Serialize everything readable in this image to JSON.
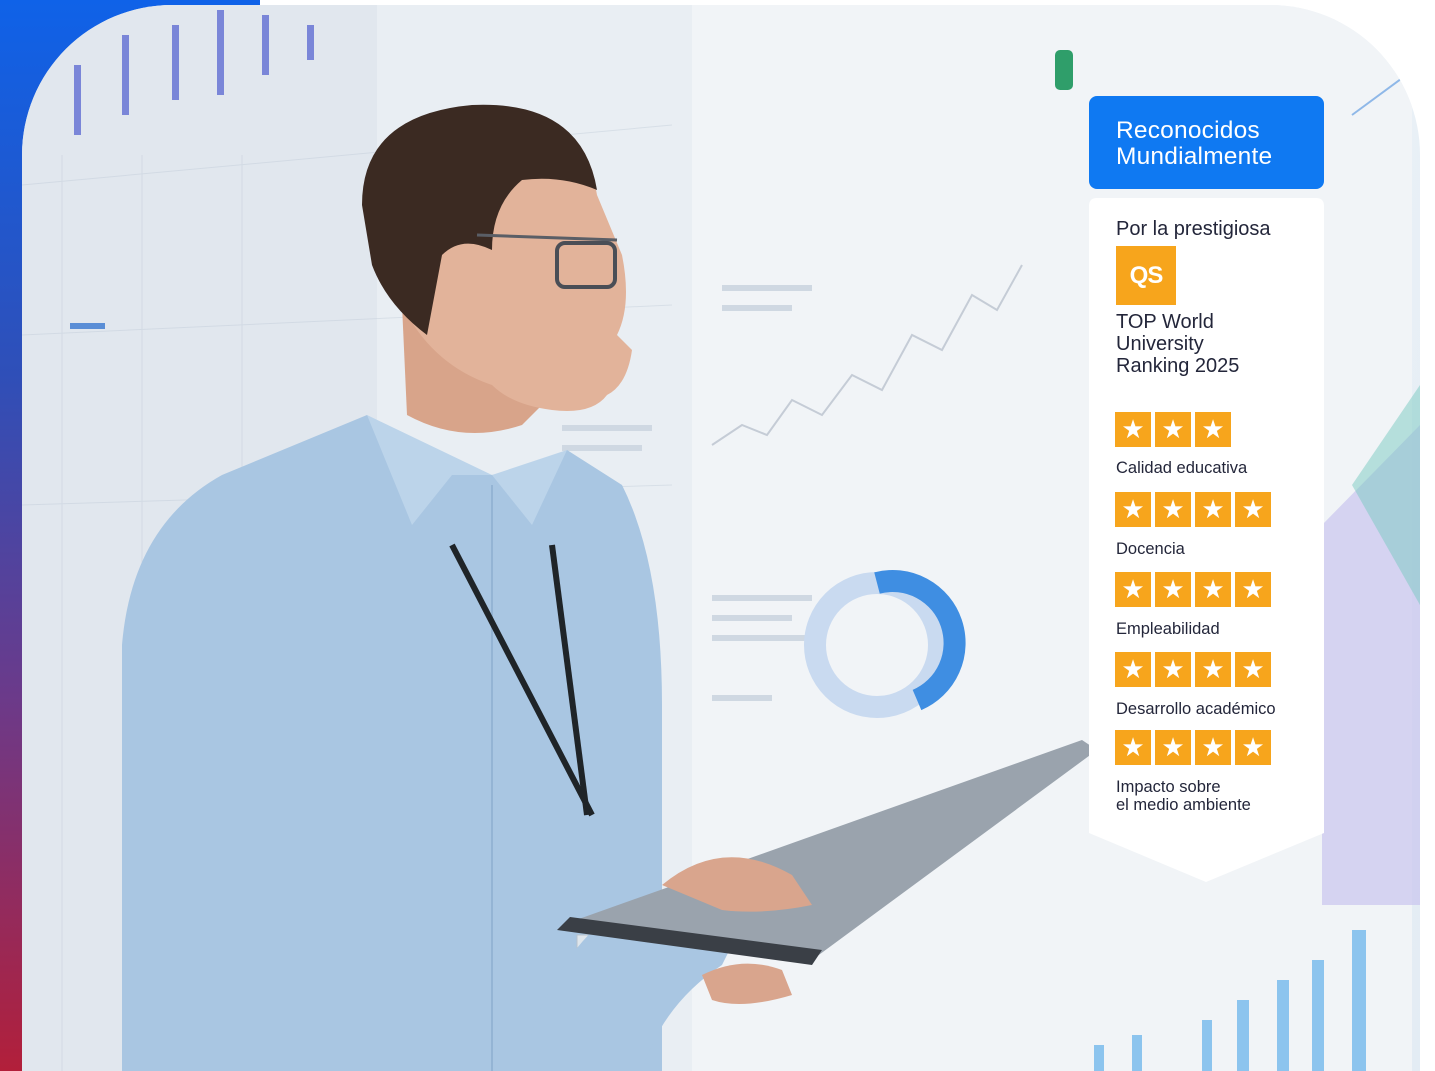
{
  "badge": {
    "header_line1": "Reconocidos",
    "header_line2": "Mundialmente",
    "intro": "Por la prestigiosa",
    "qs_logo_text": "QS",
    "ranking_line1": "TOP World",
    "ranking_line2": "University",
    "ranking_line3": "Ranking 2025",
    "ratings": [
      {
        "label": "Calidad educativa",
        "stars": 3
      },
      {
        "label": "Docencia",
        "stars": 4
      },
      {
        "label": "Empleabilidad",
        "stars": 4
      },
      {
        "label": "Desarrollo académico",
        "stars": 4
      },
      {
        "label_line1": "Impacto sobre",
        "label_line2": "el medio ambiente",
        "stars": 4
      }
    ]
  },
  "colors": {
    "header_blue": "#0f79f2",
    "star_orange": "#f7a51c",
    "text_dark": "#23263a",
    "shirt_blue": "#a9c6e2"
  }
}
